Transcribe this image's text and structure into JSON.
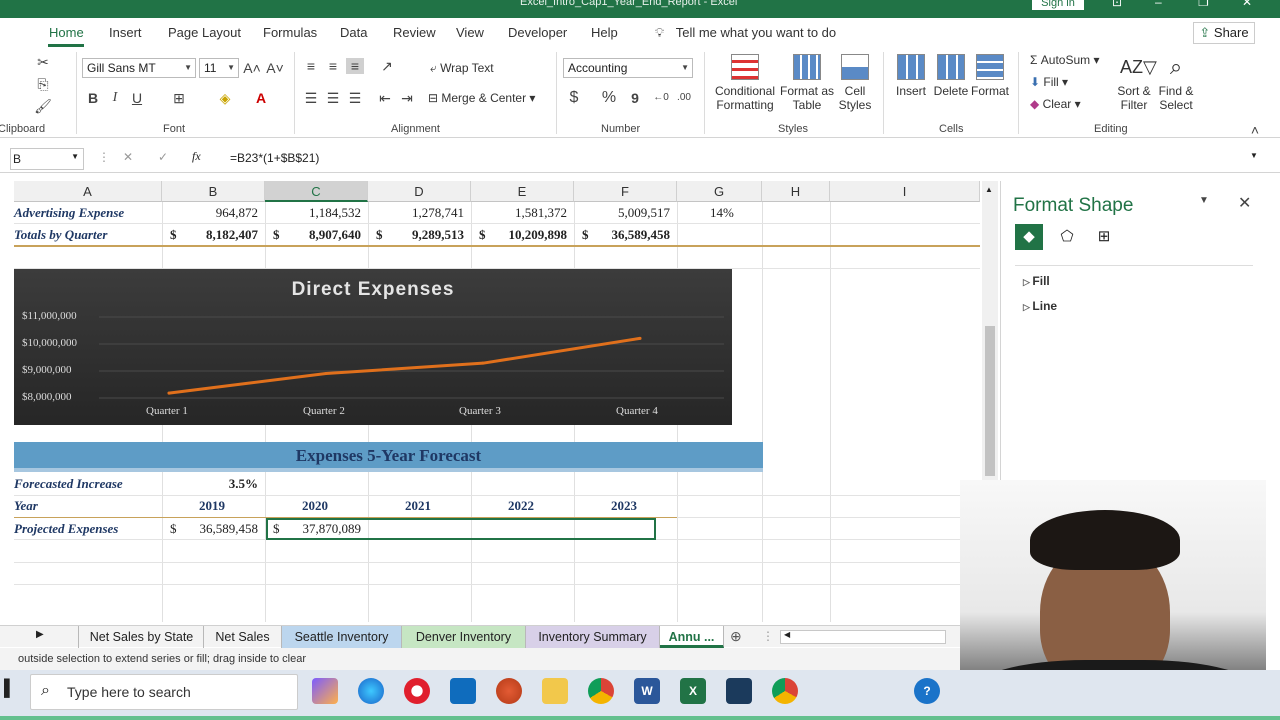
{
  "title_bar": {
    "title": "Excel_Intro_Cap1_Year_End_Report - Excel",
    "signin": "Sign in"
  },
  "ribbon_tabs": [
    "Home",
    "Insert",
    "Page Layout",
    "Formulas",
    "Data",
    "Review",
    "View",
    "Developer",
    "Help"
  ],
  "tell_me": "Tell me what you want to do",
  "share": "Share",
  "ribbon": {
    "clipboard_label": "Clipboard",
    "font_name": "Gill Sans MT",
    "font_size": "11",
    "font_label": "Font",
    "wrap_text": "Wrap Text",
    "merge_center": "Merge & Center",
    "alignment_label": "Alignment",
    "number_format": "Accounting",
    "number_label": "Number",
    "conditional_formatting": "Conditional Formatting",
    "format_as_table": "Format as Table",
    "cell_styles": "Cell Styles",
    "styles_label": "Styles",
    "insert": "Insert",
    "delete": "Delete",
    "format": "Format",
    "cells_label": "Cells",
    "autosum": "AutoSum",
    "fill": "Fill",
    "clear": "Clear",
    "sort_filter": "Sort & Filter",
    "find_select": "Find & Select",
    "editing_label": "Editing"
  },
  "formula_bar": {
    "name_box": "B",
    "fx": "fx",
    "formula": "=B23*(1+$B$21)"
  },
  "columns": [
    "A",
    "B",
    "C",
    "D",
    "E",
    "F",
    "G",
    "H",
    "I"
  ],
  "rows": {
    "advertising": {
      "label": "Advertising Expense",
      "b": "964,872",
      "c": "1,184,532",
      "d": "1,278,741",
      "e": "1,581,372",
      "f": "5,009,517",
      "g": "14%"
    },
    "totals": {
      "label": "Totals by Quarter",
      "b": "8,182,407",
      "c": "8,907,640",
      "d": "9,289,513",
      "e": "10,209,898",
      "f": "36,589,458",
      "currency": "$"
    },
    "forecast_title": "Expenses  5-Year Forecast",
    "forecasted_increase": {
      "label": "Forecasted Increase",
      "b": "3.5%"
    },
    "year": {
      "label": "Year",
      "b": "2019",
      "c": "2020",
      "d": "2021",
      "e": "2022",
      "f": "2023"
    },
    "projected": {
      "label": "Projected Expenses",
      "b": "36,589,458",
      "c": "37,870,089",
      "currency": "$"
    }
  },
  "chart_data": {
    "type": "line",
    "title": "Direct Expenses",
    "categories": [
      "Quarter 1",
      "Quarter 2",
      "Quarter 3",
      "Quarter 4"
    ],
    "series": [
      {
        "values": [
          8182407,
          8907640,
          9289513,
          10209898
        ],
        "color": "#e0701c"
      }
    ],
    "y_ticks": [
      "$8,000,000",
      "$9,000,000",
      "$10,000,000",
      "$11,000,000"
    ],
    "ylim": [
      8000000,
      11000000
    ],
    "legend": "none",
    "grid": true
  },
  "format_pane": {
    "title": "Format Shape",
    "sections": [
      "Fill",
      "Line"
    ]
  },
  "sheet_tabs": [
    "Net Sales by State",
    "Net Sales",
    "Seattle Inventory",
    "Denver Inventory",
    "Inventory Summary",
    "Annu ..."
  ],
  "status_text": "outside selection to extend series or fill; drag inside to clear",
  "taskbar": {
    "search_placeholder": "Type here to search"
  },
  "colors": {
    "excel_green": "#217346",
    "banner_blue": "#5e9cc6",
    "label_navy": "#1f3864"
  }
}
